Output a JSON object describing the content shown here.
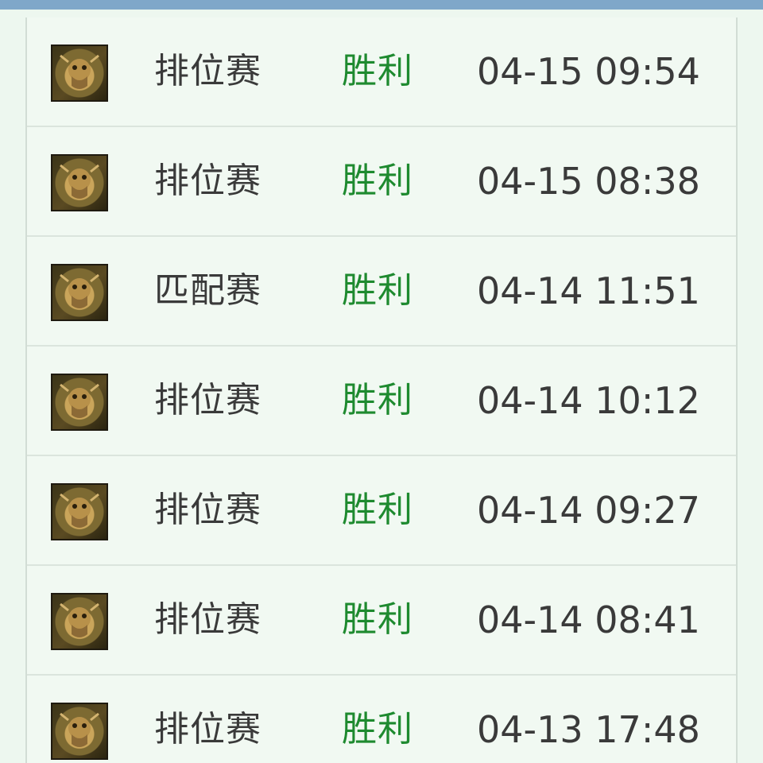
{
  "colors": {
    "win_text": "#1e8a2f",
    "header_bar": "#7fa7c9",
    "row_background": "#f1f9f2"
  },
  "matches": [
    {
      "champion_icon": "champion-portrait-icon",
      "mode": "排位赛",
      "result": "胜利",
      "time": "04-15 09:54"
    },
    {
      "champion_icon": "champion-portrait-icon",
      "mode": "排位赛",
      "result": "胜利",
      "time": "04-15 08:38"
    },
    {
      "champion_icon": "champion-portrait-icon",
      "mode": "匹配赛",
      "result": "胜利",
      "time": "04-14 11:51"
    },
    {
      "champion_icon": "champion-portrait-icon",
      "mode": "排位赛",
      "result": "胜利",
      "time": "04-14 10:12"
    },
    {
      "champion_icon": "champion-portrait-icon",
      "mode": "排位赛",
      "result": "胜利",
      "time": "04-14 09:27"
    },
    {
      "champion_icon": "champion-portrait-icon",
      "mode": "排位赛",
      "result": "胜利",
      "time": "04-14 08:41"
    },
    {
      "champion_icon": "champion-portrait-icon",
      "mode": "排位赛",
      "result": "胜利",
      "time": "04-13 17:48"
    }
  ]
}
